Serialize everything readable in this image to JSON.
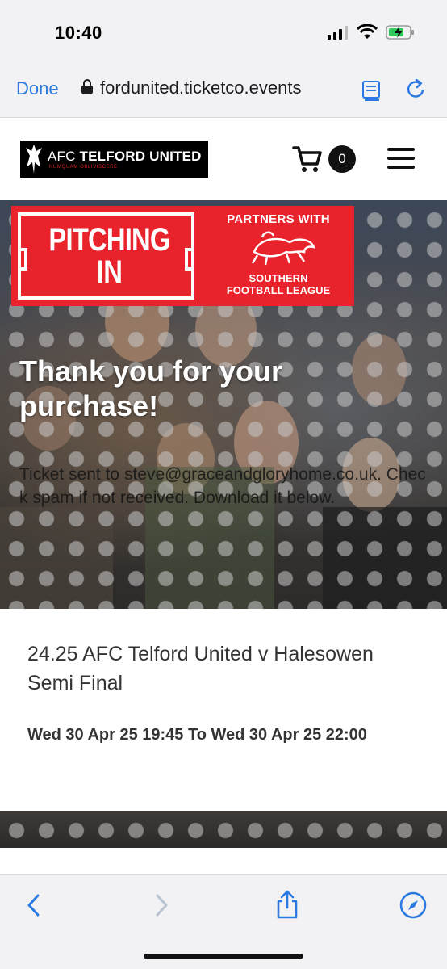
{
  "status_bar": {
    "time": "10:40",
    "icons": [
      "signal-icon",
      "wifi-icon",
      "battery-charging-icon"
    ],
    "battery_color": "#34c759"
  },
  "browser": {
    "done_label": "Done",
    "url": "fordunited.ticketco.events",
    "icons": [
      "lock-icon",
      "reader-mode-icon",
      "reload-icon"
    ],
    "accent_color": "#2a7ae2"
  },
  "site_header": {
    "logo_text_thin": "AFC",
    "logo_text_bold": "TELFORD UNITED",
    "logo_motto": "NUMQUAM OBLIVISCERE",
    "cart_count": "0",
    "icons": [
      "cart-icon",
      "hamburger-menu-icon"
    ]
  },
  "hero": {
    "banner": {
      "pitching_line1": "PITCHING",
      "pitching_line2": "IN",
      "partners_with": "PARTNERS WITH",
      "league_line1": "SOUTHERN",
      "league_line2": "FOOTBALL LEAGUE",
      "banner_color": "#e8232b"
    },
    "thank_you": "Thank you for your purchase!",
    "sent_message": "Ticket sent to steve@graceandgloryhome.co.uk. Check spam if not received. Download it below."
  },
  "event": {
    "title": "24.25 AFC Telford United v Halesowen Semi Final",
    "dates": "Wed 30 Apr 25 19:45 To Wed 30 Apr 25 22:00"
  },
  "toolbar": {
    "icons": [
      "back-icon",
      "forward-icon",
      "share-icon",
      "compass-icon"
    ]
  }
}
